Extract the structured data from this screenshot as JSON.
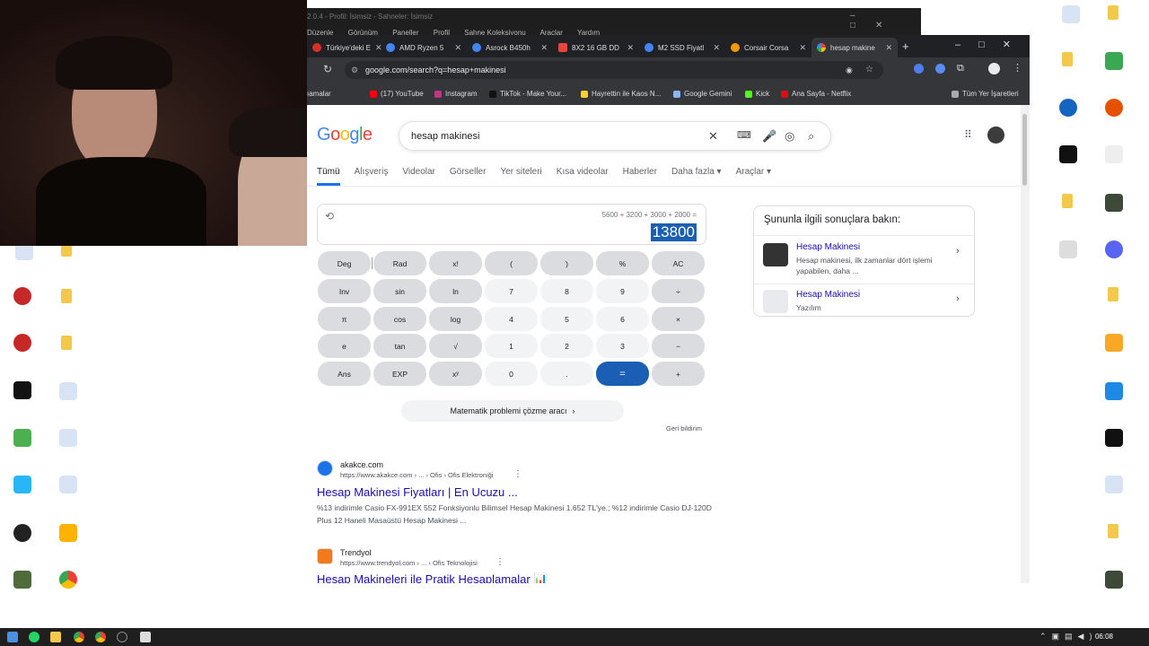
{
  "obs": {
    "title": "2.0.4 - Profil: İsimsiz - Sahneler: İsimsiz",
    "menu": [
      "Düzenle",
      "Görünüm",
      "Paneller",
      "Profil",
      "Sahne Koleksiyonu",
      "Araçlar",
      "Yardım"
    ]
  },
  "browser": {
    "tabs": [
      {
        "label": "Türkiye'deki E",
        "color": "#d93025"
      },
      {
        "label": "AMD Ryzen 5",
        "color": "#4285f4"
      },
      {
        "label": "Asrock B450h",
        "color": "#4285f4"
      },
      {
        "label": "8X2 16 GB DD",
        "color": "#e8453c"
      },
      {
        "label": "M2 SSD Fiyatl",
        "color": "#4285f4"
      },
      {
        "label": "Corsair Corsa",
        "color": "#f29900"
      },
      {
        "label": "hesap makine",
        "color": "#4285f4"
      }
    ],
    "url": "google.com/search?q=hesap+makinesi",
    "bookmarks": [
      "ıamalar",
      "(17) YouTube",
      "Instagram",
      "TikTok - Make Your...",
      "Hayrettin ile Kaos N...",
      "Google Gemini",
      "Kick",
      "Ana Sayfa - Netflix"
    ],
    "all_bookmarks": "Tüm Yer İşaretleri"
  },
  "google": {
    "logo": "Google",
    "query": "hesap makinesi",
    "nav": [
      "Tümü",
      "Alışveriş",
      "Videolar",
      "Görseller",
      "Yer siteleri",
      "Kısa videolar",
      "Haberler",
      "Daha fazla ▾",
      "Araçlar ▾"
    ],
    "calc": {
      "expression": "5600 + 3200 + 3000 + 2000 =",
      "result": "13800",
      "keys": [
        [
          "Deg",
          "Rad",
          "x!",
          "(",
          ")",
          "%",
          "AC"
        ],
        [
          "Inv",
          "sin",
          "ln",
          "7",
          "8",
          "9",
          "÷"
        ],
        [
          "π",
          "cos",
          "log",
          "4",
          "5",
          "6",
          "×"
        ],
        [
          "e",
          "tan",
          "√",
          "1",
          "2",
          "3",
          "−"
        ],
        [
          "Ans",
          "EXP",
          "xʸ",
          "0",
          ".",
          "=",
          "+"
        ]
      ],
      "math_tool": "Matematik problemi çözme aracı",
      "feedback": "Geri bildirim"
    },
    "side": {
      "heading": "Şununla ilgili sonuçlara bakın:",
      "items": [
        {
          "title": "Hesap Makinesi",
          "sub": "Hesap makinesi, ilk zamanlar dört işlemi yapabilen, daha ..."
        },
        {
          "title": "Hesap Makinesi",
          "sub": "Yazılım"
        }
      ]
    },
    "results": [
      {
        "site": "akakce.com",
        "url": "https://www.akakce.com › ... › Ofis › Ofis Elektroniği",
        "title": "Hesap Makinesi Fiyatları | En Ucuzu ...",
        "snippet": "%13 indirimle Casio FX-991EX 552 Fonksiyonlu Bilimsel Hesap Makinesi 1.652 TL'ye.; %12 indirimle Casio DJ-120D Plus 12 Haneli Masaüstü Hesap Makinesi ..."
      },
      {
        "site": "Trendyol",
        "url": "https://www.trendyol.com › ... › Ofis Teknolojisi",
        "title": "Hesap Makineleri ile Pratik Hesaplamalar 📊",
        "snippet": ""
      }
    ]
  },
  "taskbar": {
    "time": "06:08"
  }
}
